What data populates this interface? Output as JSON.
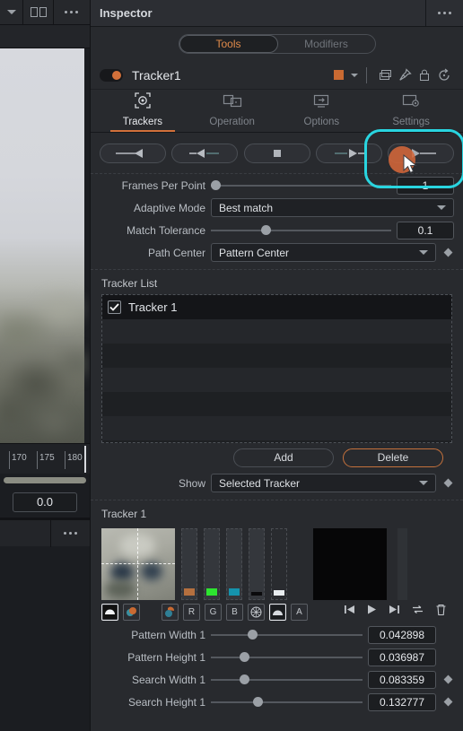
{
  "left_panel": {
    "toolbar": {
      "chevron_icon": "chevron-down-icon",
      "split_icon": "split-view-icon",
      "more_icon": "ellipsis-icon"
    },
    "ruler": {
      "ticks": [
        "170",
        "175",
        "180"
      ]
    },
    "time_field": {
      "value": "0.0"
    },
    "bottom": {
      "more_icon": "ellipsis-icon"
    }
  },
  "inspector": {
    "title": "Inspector",
    "more_icon": "ellipsis-icon",
    "segmented": {
      "tools": "Tools",
      "modifiers": "Modifiers",
      "active": "Tools"
    },
    "node": {
      "name": "Tracker1",
      "enabled": true,
      "color_swatch": "#c96a32",
      "icons": [
        "duplicate-icon",
        "pin-icon",
        "lock-icon",
        "reset-icon"
      ]
    },
    "tabs": [
      {
        "label": "Trackers",
        "icon": "tracker-target-icon",
        "active": true
      },
      {
        "label": "Operation",
        "icon": "operation-panels-icon",
        "active": false
      },
      {
        "label": "Options",
        "icon": "options-monitor-icon",
        "active": false
      },
      {
        "label": "Settings",
        "icon": "settings-gear-icon",
        "active": false
      }
    ],
    "transport": [
      {
        "name": "track-reverse-to-start",
        "icon": "track-reverse-icon"
      },
      {
        "name": "track-reverse-step",
        "icon": "step-reverse-icon"
      },
      {
        "name": "stop-tracking",
        "icon": "stop-icon"
      },
      {
        "name": "track-forward-step",
        "icon": "step-forward-icon"
      },
      {
        "name": "track-forward-to-end",
        "icon": "track-forward-icon"
      }
    ],
    "params": {
      "frames_per_point": {
        "label": "Frames Per Point",
        "value": "1",
        "knob_pct": 0
      },
      "adaptive_mode": {
        "label": "Adaptive Mode",
        "value": "Best match"
      },
      "match_tolerance": {
        "label": "Match Tolerance",
        "value": "0.1",
        "knob_pct": 28
      },
      "path_center": {
        "label": "Path Center",
        "value": "Pattern Center"
      }
    },
    "tracker_list": {
      "section_label": "Tracker List",
      "items": [
        {
          "name": "Tracker 1",
          "checked": true
        }
      ],
      "add_label": "Add",
      "delete_label": "Delete"
    },
    "show": {
      "label": "Show",
      "value": "Selected Tracker"
    },
    "tracker_detail": {
      "section_label": "Tracker 1",
      "channel_colors": [
        "#b5703f",
        "#2de530",
        "#1593ad",
        "#0a0a0c",
        "#e8ecef"
      ],
      "buttons": [
        "pattern-preview-icon",
        "color-preview-icon",
        "palette-icon",
        "R",
        "G",
        "B",
        "checker-icon",
        "gradient-icon",
        "A"
      ],
      "playback": [
        "skip-start-icon",
        "play-icon",
        "skip-end-icon",
        "loop-icon",
        "trash-icon"
      ],
      "sliders": [
        {
          "label": "Pattern Width 1",
          "value": "0.042898",
          "knob_pct": 24,
          "keyframe": false
        },
        {
          "label": "Pattern Height 1",
          "value": "0.036987",
          "knob_pct": 19,
          "keyframe": false
        },
        {
          "label": "Search Width 1",
          "value": "0.083359",
          "knob_pct": 19,
          "keyframe": true
        },
        {
          "label": "Search Height 1",
          "value": "0.132777",
          "knob_pct": 28,
          "keyframe": true
        }
      ]
    }
  },
  "annotation": {
    "highlight_color": "#29d5e0",
    "click_color": "#d4673a"
  }
}
